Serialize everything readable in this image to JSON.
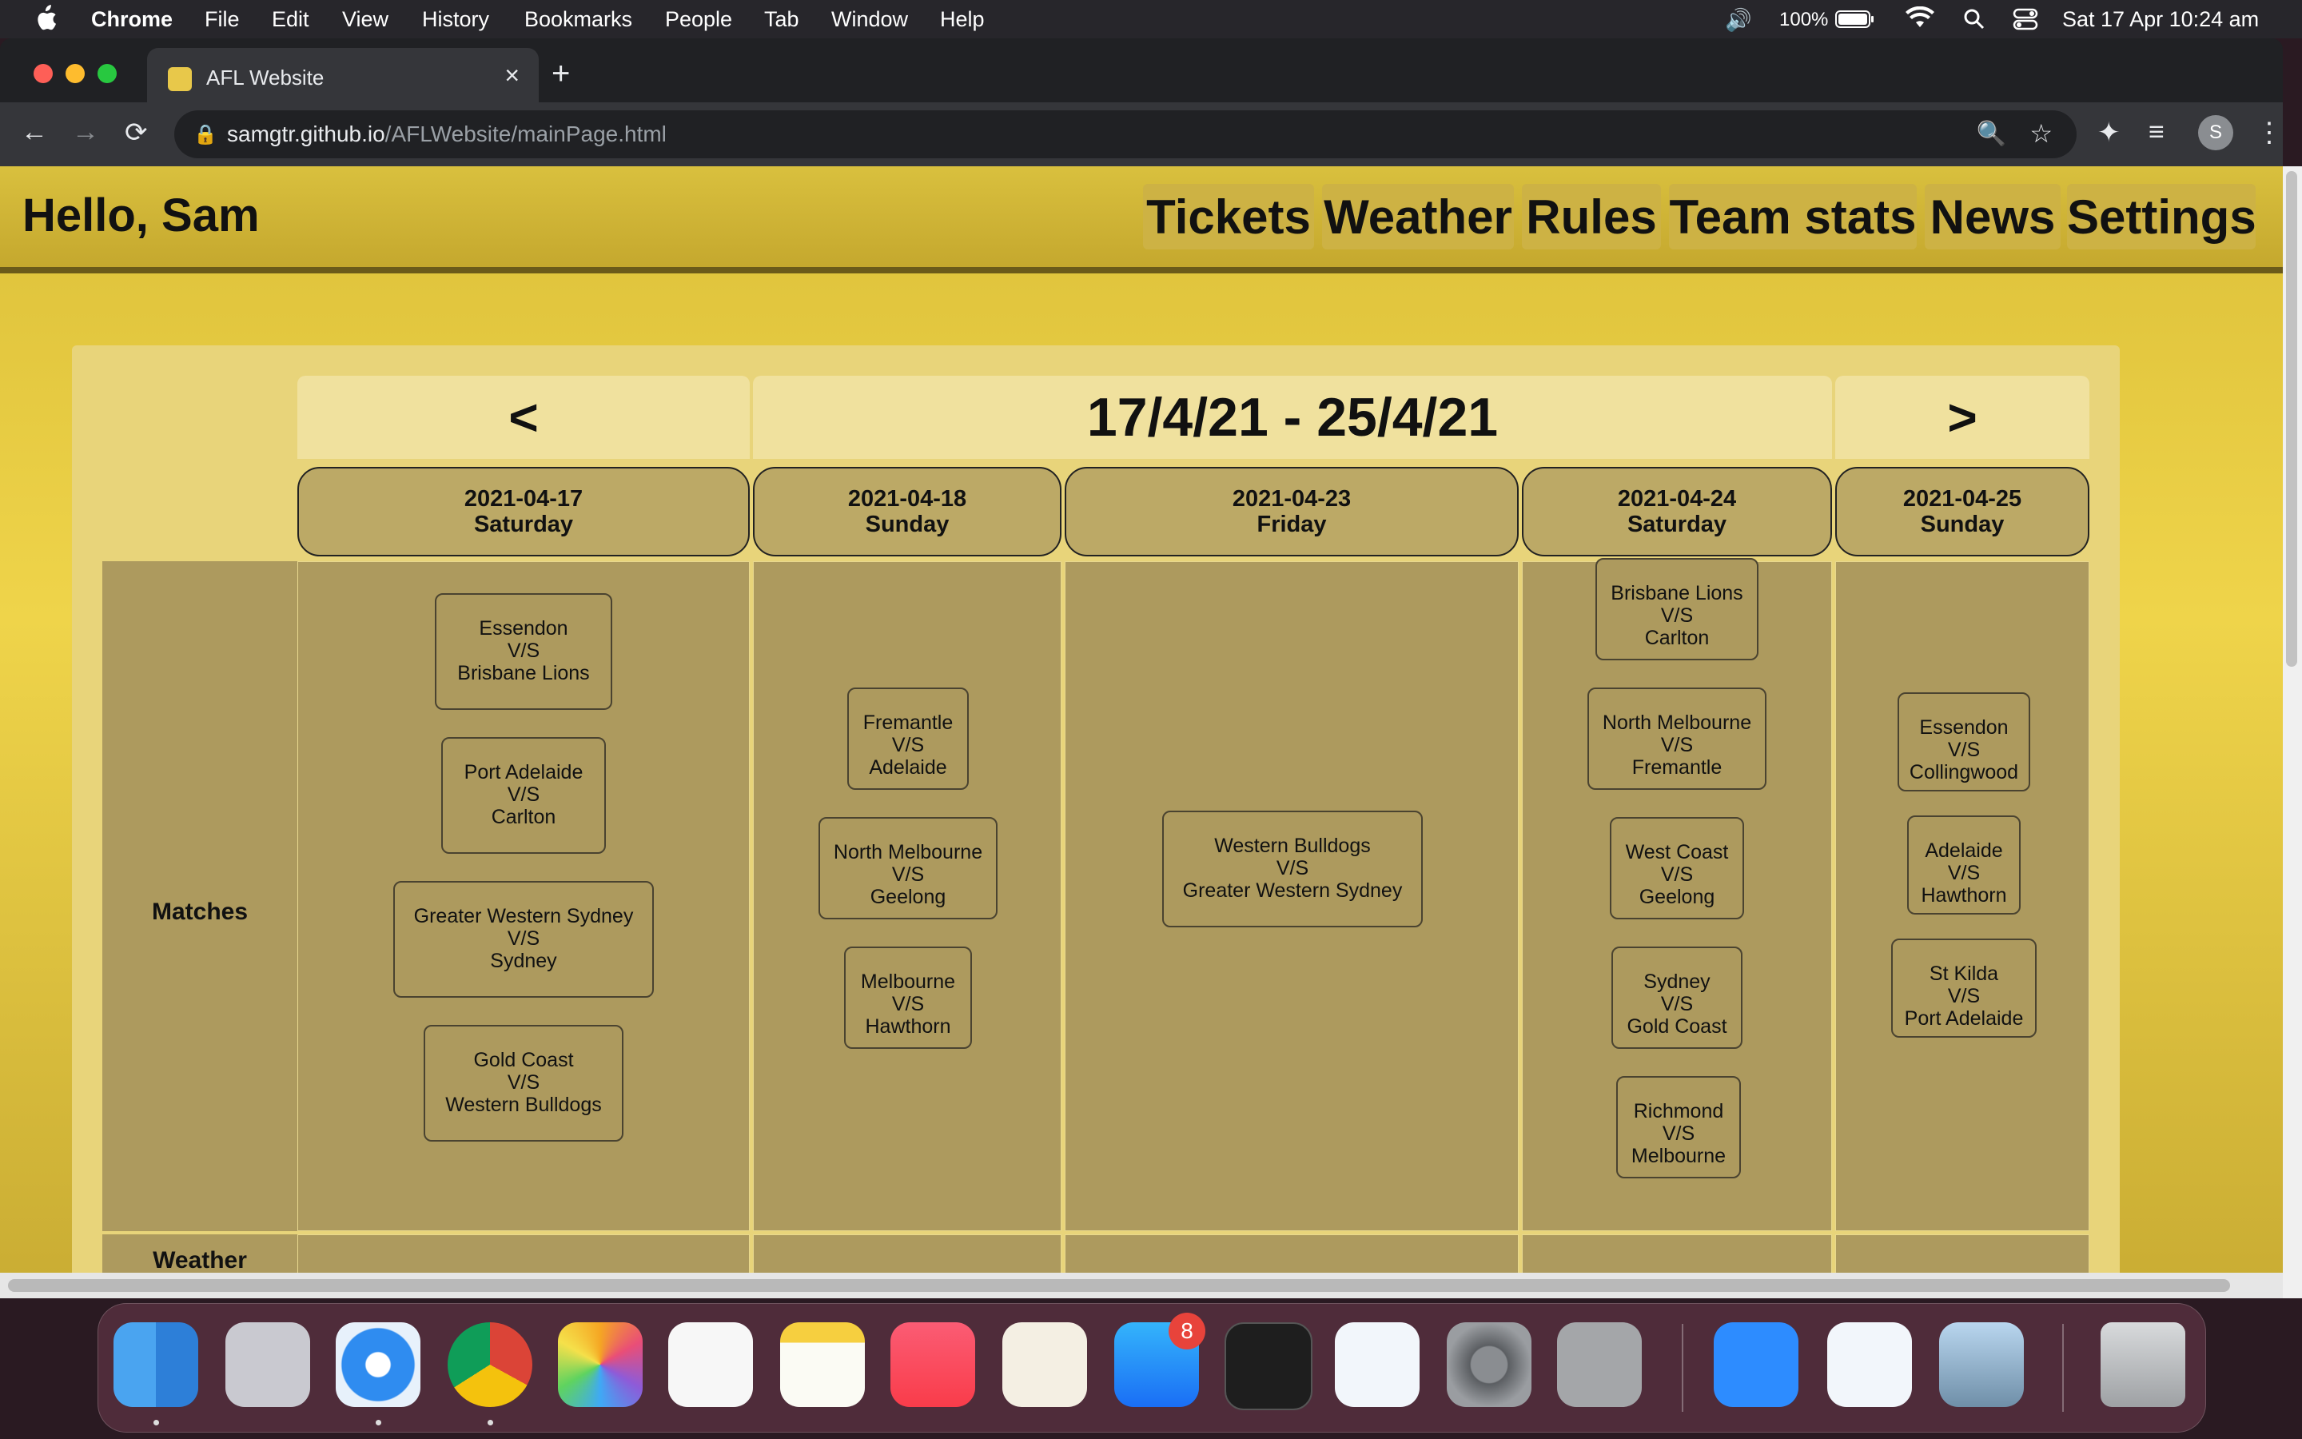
{
  "menubar": {
    "app": "Chrome",
    "items": [
      "File",
      "Edit",
      "View",
      "History",
      "Bookmarks",
      "People",
      "Tab",
      "Window",
      "Help"
    ],
    "battery": "100%",
    "datetime": "Sat 17 Apr  10:24 am"
  },
  "browser": {
    "tab_title": "AFL Website",
    "url_host": "samgtr.github.io",
    "url_path": "/AFLWebsite/mainPage.html",
    "profile_initial": "S"
  },
  "site": {
    "greeting": "Hello, Sam",
    "nav": [
      "Tickets",
      "Weather",
      "Rules",
      "Team stats",
      "News",
      "Settings"
    ]
  },
  "schedule": {
    "prev": "<",
    "next": ">",
    "range": "17/4/21 - 25/4/21",
    "row_matches": "Matches",
    "row_weather": "Weather",
    "days": [
      {
        "date": "2021-04-17",
        "weekday": "Saturday",
        "matches": [
          {
            "home": "Essendon",
            "vs": "V/S",
            "away": "Brisbane Lions"
          },
          {
            "home": "Port Adelaide",
            "vs": "V/S",
            "away": "Carlton"
          },
          {
            "home": "Greater Western Sydney",
            "vs": "V/S",
            "away": "Sydney"
          },
          {
            "home": "Gold Coast",
            "vs": "V/S",
            "away": "Western Bulldogs"
          }
        ]
      },
      {
        "date": "2021-04-18",
        "weekday": "Sunday",
        "matches": [
          {
            "home": "Fremantle",
            "vs": "V/S",
            "away": "Adelaide"
          },
          {
            "home": "North Melbourne",
            "vs": "V/S",
            "away": "Geelong"
          },
          {
            "home": "Melbourne",
            "vs": "V/S",
            "away": "Hawthorn"
          }
        ]
      },
      {
        "date": "2021-04-23",
        "weekday": "Friday",
        "matches": [
          {
            "home": "Western Bulldogs",
            "vs": "V/S",
            "away": "Greater Western Sydney"
          }
        ]
      },
      {
        "date": "2021-04-24",
        "weekday": "Saturday",
        "matches": [
          {
            "home": "Brisbane Lions",
            "vs": "V/S",
            "away": "Carlton"
          },
          {
            "home": "North Melbourne",
            "vs": "V/S",
            "away": "Fremantle"
          },
          {
            "home": "West Coast",
            "vs": "V/S",
            "away": "Geelong"
          },
          {
            "home": "Sydney",
            "vs": "V/S",
            "away": "Gold Coast"
          },
          {
            "home": "Richmond",
            "vs": "V/S",
            "away": "Melbourne"
          }
        ]
      },
      {
        "date": "2021-04-25",
        "weekday": "Sunday",
        "matches": [
          {
            "home": "Essendon",
            "vs": "V/S",
            "away": "Collingwood"
          },
          {
            "home": "Adelaide",
            "vs": "V/S",
            "away": "Hawthorn"
          },
          {
            "home": "St Kilda",
            "vs": "V/S",
            "away": "Port Adelaide"
          }
        ]
      }
    ]
  },
  "dock": {
    "icons": [
      "finder-icon",
      "launchpad-icon",
      "safari-icon",
      "chrome-icon",
      "photos-icon",
      "reminders-icon",
      "notes-icon",
      "music-icon",
      "scripteditor-icon",
      "appstore-icon",
      "terminal-icon",
      "vscode-icon",
      "systempreferences-icon",
      "calculator-icon",
      "zoom-icon",
      "vscode-icon",
      "preview-icon",
      "trash-icon"
    ],
    "appstore_badge": "8"
  }
}
